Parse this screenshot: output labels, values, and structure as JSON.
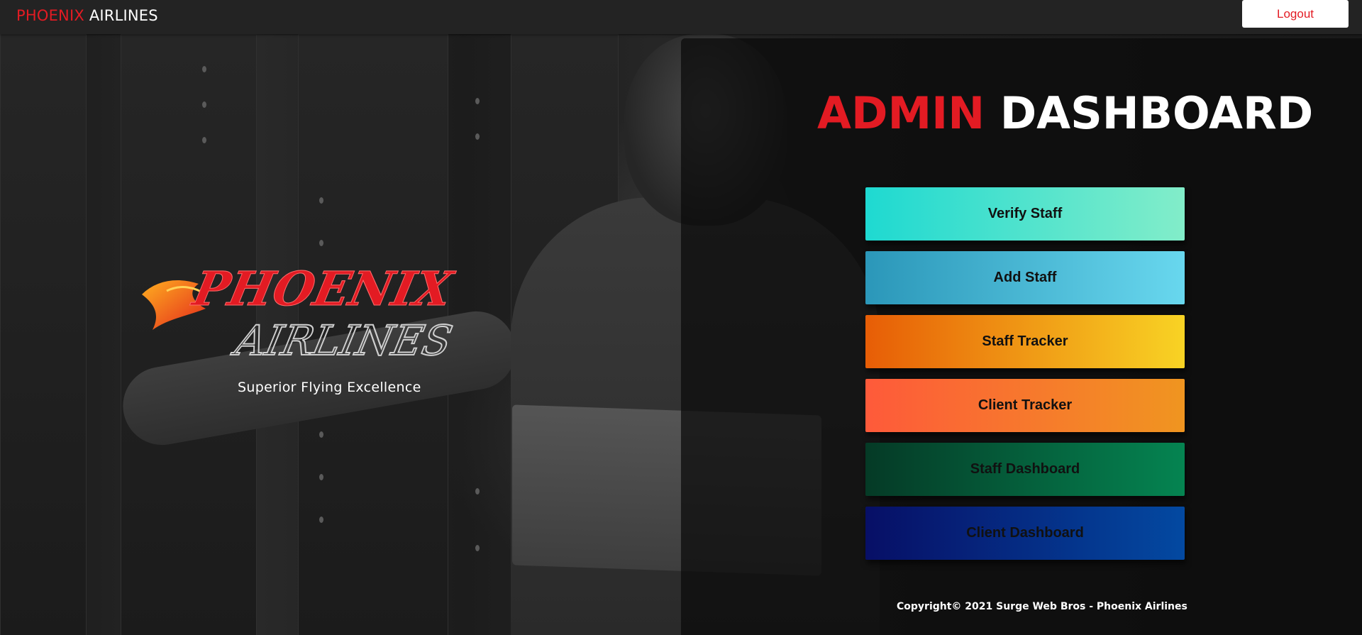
{
  "navbar": {
    "brand_red": "PHOENIX",
    "brand_white": "AIRLINES",
    "logout_label": "Logout"
  },
  "hero": {
    "logo_text_top": "PHOENIX",
    "logo_text_bottom": "AIRLINES",
    "tagline": "Superior Flying Excellence"
  },
  "dashboard": {
    "title_red": "ADMIN",
    "title_white": "DASHBOARD",
    "buttons": [
      {
        "label": "Verify Staff"
      },
      {
        "label": "Add Staff"
      },
      {
        "label": "Staff Tracker"
      },
      {
        "label": "Client Tracker"
      },
      {
        "label": "Staff Dashboard"
      },
      {
        "label": "Client Dashboard"
      }
    ]
  },
  "footer": {
    "copyright": "Copyright© 2021 Surge Web Bros - Phoenix Airlines"
  },
  "colors": {
    "brand_red": "#e31b23",
    "navbar_bg": "#232323"
  },
  "icons": {
    "logo": "phoenix-bird-icon"
  }
}
